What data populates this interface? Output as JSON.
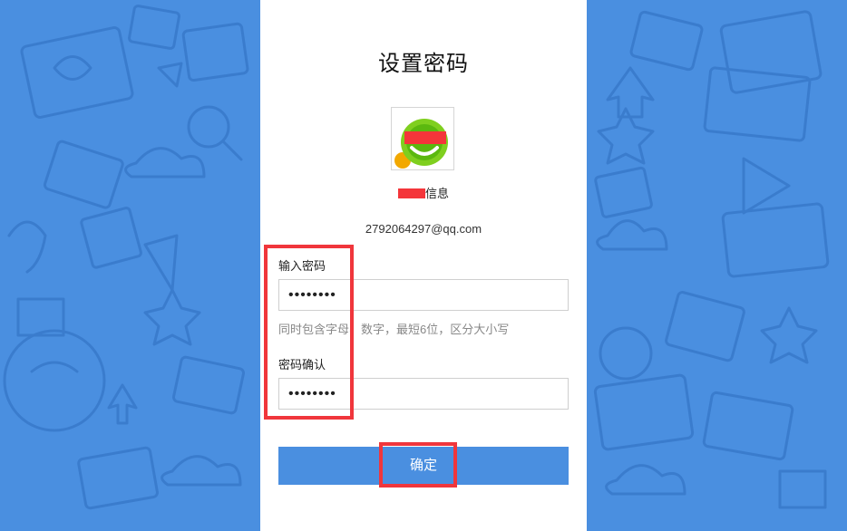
{
  "page": {
    "title": "设置密码",
    "account_name_suffix": "信息",
    "email": "2792064297@qq.com"
  },
  "form": {
    "password_label": "输入密码",
    "password_value": "••••••••",
    "hint": "同时包含字母、数字，最短6位，区分大小写",
    "confirm_label": "密码确认",
    "confirm_value": "••••••••",
    "submit_label": "确定"
  },
  "colors": {
    "background": "#4a8fe0",
    "button": "#4a8fe0",
    "highlight": "#f0363c"
  },
  "icons": [
    "avatar-icon"
  ]
}
